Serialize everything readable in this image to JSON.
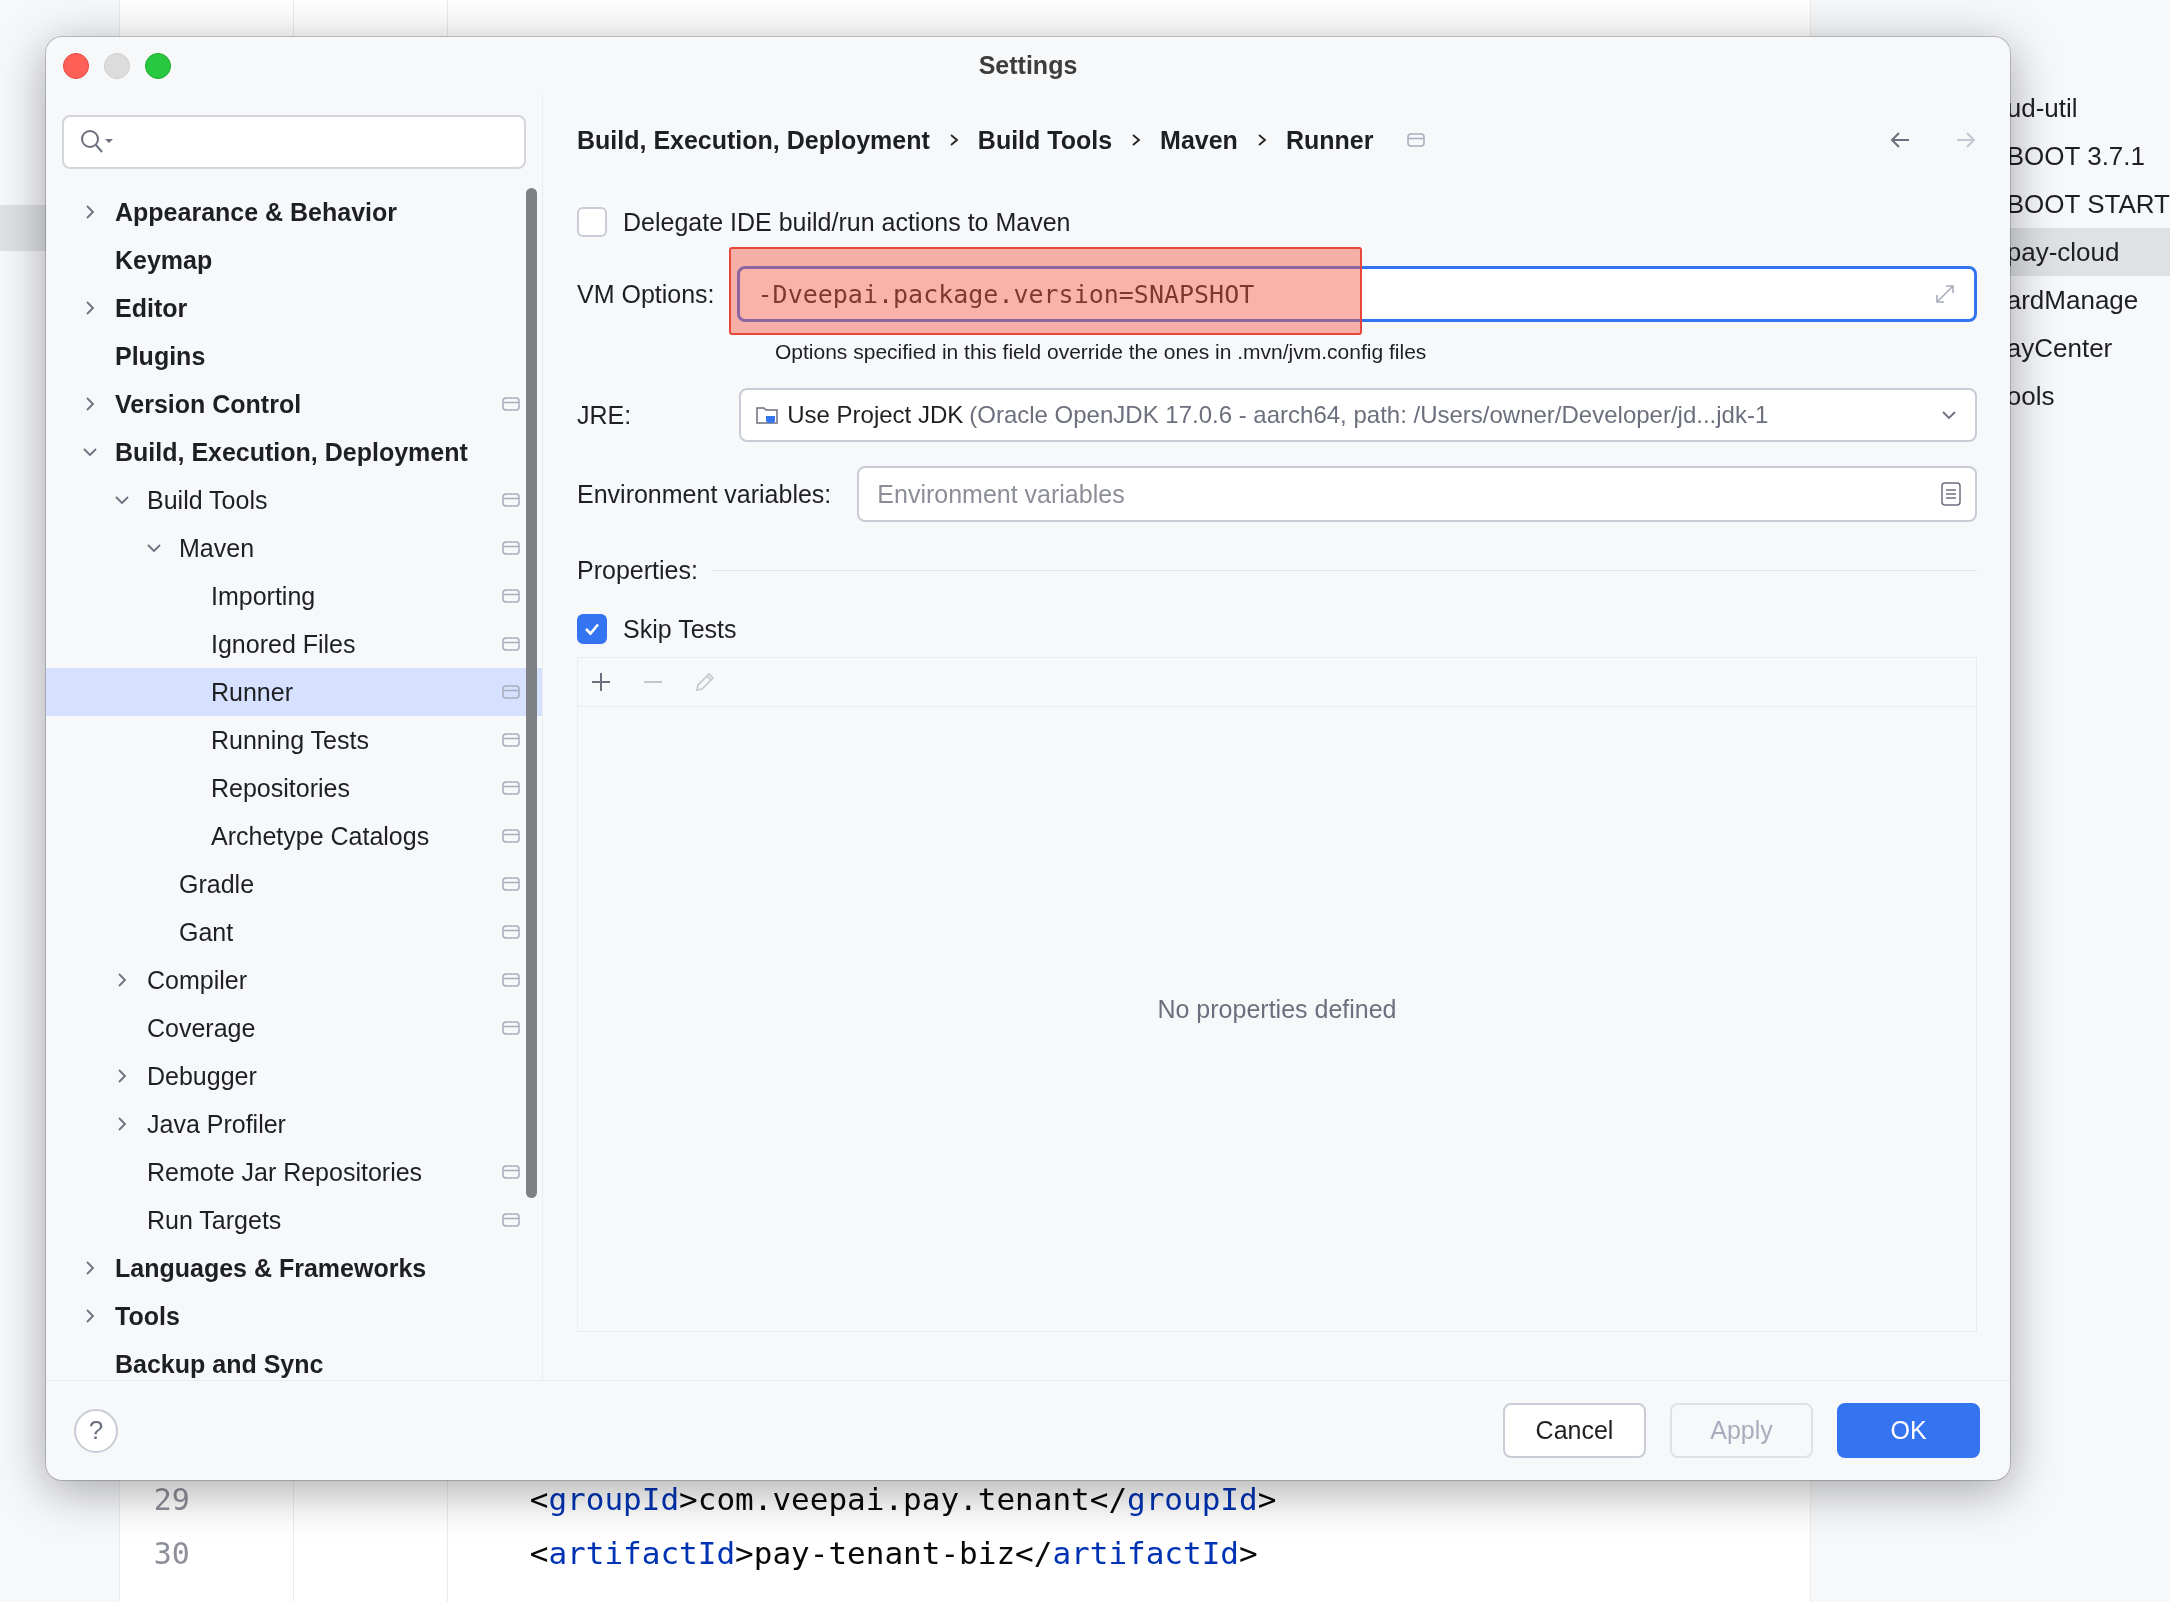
{
  "editor": {
    "lines": [
      {
        "number": "29",
        "code": "<groupId>com.veepai.pay.tenant</groupId>"
      },
      {
        "number": "30",
        "code": "<artifactId>pay-tenant-biz</artifactId>"
      }
    ]
  },
  "project_panel": {
    "items": [
      {
        "label": "ud-util",
        "selected": false
      },
      {
        "label": "BOOT 3.7.1",
        "selected": false
      },
      {
        "label": "BOOT START",
        "selected": false
      },
      {
        "label": "pay-cloud",
        "selected": true
      },
      {
        "label": "ardManage",
        "selected": false
      },
      {
        "label": "ayCenter",
        "selected": false
      },
      {
        "label": "ools",
        "selected": false
      }
    ]
  },
  "dialog": {
    "title": "Settings",
    "sidebar": {
      "tree": [
        {
          "label": "Appearance & Behavior",
          "kind": "folder",
          "expanded": false,
          "selected": false,
          "project_level": false
        },
        {
          "label": "Keymap",
          "kind": "leaf",
          "selected": false,
          "project_level": false
        },
        {
          "label": "Editor",
          "kind": "folder",
          "expanded": false,
          "selected": false,
          "project_level": false
        },
        {
          "label": "Plugins",
          "kind": "leaf",
          "selected": false,
          "project_level": false
        },
        {
          "label": "Version Control",
          "kind": "folder",
          "expanded": false,
          "selected": false,
          "project_level": true
        },
        {
          "label": "Build, Execution, Deployment",
          "kind": "folder",
          "expanded": true,
          "selected": false,
          "project_level": false,
          "children": [
            {
              "label": "Build Tools",
              "kind": "folder",
              "expanded": true,
              "selected": false,
              "project_level": true,
              "children": [
                {
                  "label": "Maven",
                  "kind": "folder",
                  "expanded": true,
                  "selected": false,
                  "project_level": true,
                  "children": [
                    {
                      "label": "Importing",
                      "kind": "leaf",
                      "selected": false,
                      "project_level": true
                    },
                    {
                      "label": "Ignored Files",
                      "kind": "leaf",
                      "selected": false,
                      "project_level": true
                    },
                    {
                      "label": "Runner",
                      "kind": "leaf",
                      "selected": true,
                      "project_level": true
                    },
                    {
                      "label": "Running Tests",
                      "kind": "leaf",
                      "selected": false,
                      "project_level": true
                    },
                    {
                      "label": "Repositories",
                      "kind": "leaf",
                      "selected": false,
                      "project_level": true
                    },
                    {
                      "label": "Archetype Catalogs",
                      "kind": "leaf",
                      "selected": false,
                      "project_level": true
                    }
                  ]
                },
                {
                  "label": "Gradle",
                  "kind": "leaf",
                  "selected": false,
                  "project_level": true
                },
                {
                  "label": "Gant",
                  "kind": "leaf",
                  "selected": false,
                  "project_level": true
                }
              ]
            },
            {
              "label": "Compiler",
              "kind": "folder",
              "expanded": false,
              "selected": false,
              "project_level": true
            },
            {
              "label": "Coverage",
              "kind": "leaf",
              "selected": false,
              "project_level": true
            },
            {
              "label": "Debugger",
              "kind": "folder",
              "expanded": false,
              "selected": false,
              "project_level": false
            },
            {
              "label": "Java Profiler",
              "kind": "folder",
              "expanded": false,
              "selected": false,
              "project_level": false
            },
            {
              "label": "Remote Jar Repositories",
              "kind": "leaf",
              "selected": false,
              "project_level": true
            },
            {
              "label": "Run Targets",
              "kind": "leaf",
              "selected": false,
              "project_level": true
            }
          ]
        },
        {
          "label": "Languages & Frameworks",
          "kind": "folder",
          "expanded": false,
          "selected": false,
          "project_level": false
        },
        {
          "label": "Tools",
          "kind": "folder",
          "expanded": false,
          "selected": false,
          "project_level": false
        },
        {
          "label": "Backup and Sync",
          "kind": "leaf",
          "selected": false,
          "project_level": false
        }
      ]
    },
    "breadcrumb": [
      "Build, Execution, Deployment",
      "Build Tools",
      "Maven",
      "Runner"
    ],
    "nav": [
      {
        "kind": "back",
        "disabled": false
      },
      {
        "kind": "forward",
        "disabled": true
      }
    ],
    "delegate": {
      "label": "Delegate IDE build/run actions to Maven",
      "checked": false
    },
    "vm_options": {
      "label": "VM Options:",
      "value": "-Dveepai.package.version=SNAPSHOT",
      "focused": true,
      "highlighted": true,
      "hint": "Options specified in this field override the ones in .mvn/jvm.config files"
    },
    "jre": {
      "label": "JRE:",
      "value": "Use Project JDK",
      "detail": "(Oracle OpenJDK 17.0.6 - aarch64, path: /Users/owner/Developer/jd...jdk-1"
    },
    "env": {
      "label": "Environment variables:",
      "placeholder": "Environment variables"
    },
    "properties": {
      "label": "Properties:",
      "skip_tests": {
        "label": "Skip Tests",
        "checked": true
      },
      "toolbar": [
        {
          "kind": "add",
          "disabled": false
        },
        {
          "kind": "remove",
          "disabled": true
        },
        {
          "kind": "edit",
          "disabled": true
        }
      ],
      "empty_text": "No properties defined"
    },
    "footer": {
      "help": "?",
      "buttons": [
        {
          "label": "Cancel",
          "kind": "default",
          "disabled": false
        },
        {
          "label": "Apply",
          "kind": "default",
          "disabled": true
        },
        {
          "label": "OK",
          "kind": "primary",
          "disabled": false
        }
      ]
    }
  }
}
